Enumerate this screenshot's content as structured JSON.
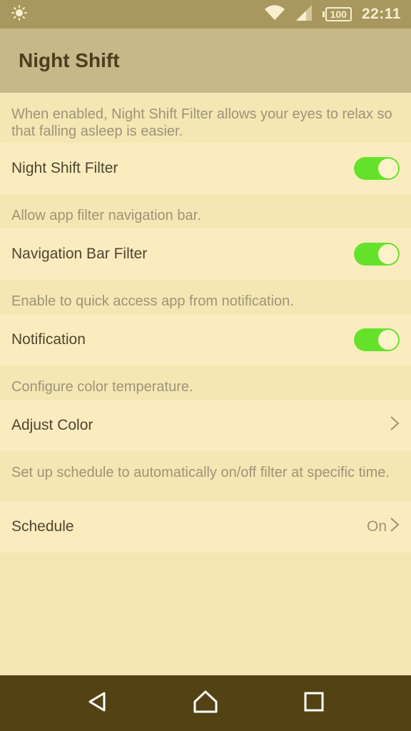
{
  "status_bar": {
    "battery": "100",
    "time": "22:11",
    "icons": [
      "brightness-icon",
      "wifi-icon",
      "signal-icon",
      "battery-icon"
    ]
  },
  "app_bar": {
    "title": "Night Shift"
  },
  "settings": {
    "night_shift_desc": "When enabled, Night Shift Filter allows your eyes to relax so that falling asleep is easier.",
    "night_shift_label": "Night Shift Filter",
    "night_shift_on": true,
    "nav_desc": "Allow app filter navigation bar.",
    "nav_label": "Navigation Bar Filter",
    "nav_on": true,
    "notif_desc": "Enable to quick access app from notification.",
    "notif_label": "Notification",
    "notif_on": true,
    "color_desc": "Configure color temperature.",
    "color_label": "Adjust Color",
    "schedule_desc": "Set up schedule to automatically on/off filter at specific time.",
    "schedule_label": "Schedule",
    "schedule_value": "On"
  },
  "colors": {
    "accent_toggle": "#64e22b",
    "app_bar": "#c7b889",
    "nav_bar": "#534314"
  },
  "nav_bar": {
    "icons": [
      "back-icon",
      "home-icon",
      "recents-icon"
    ]
  }
}
